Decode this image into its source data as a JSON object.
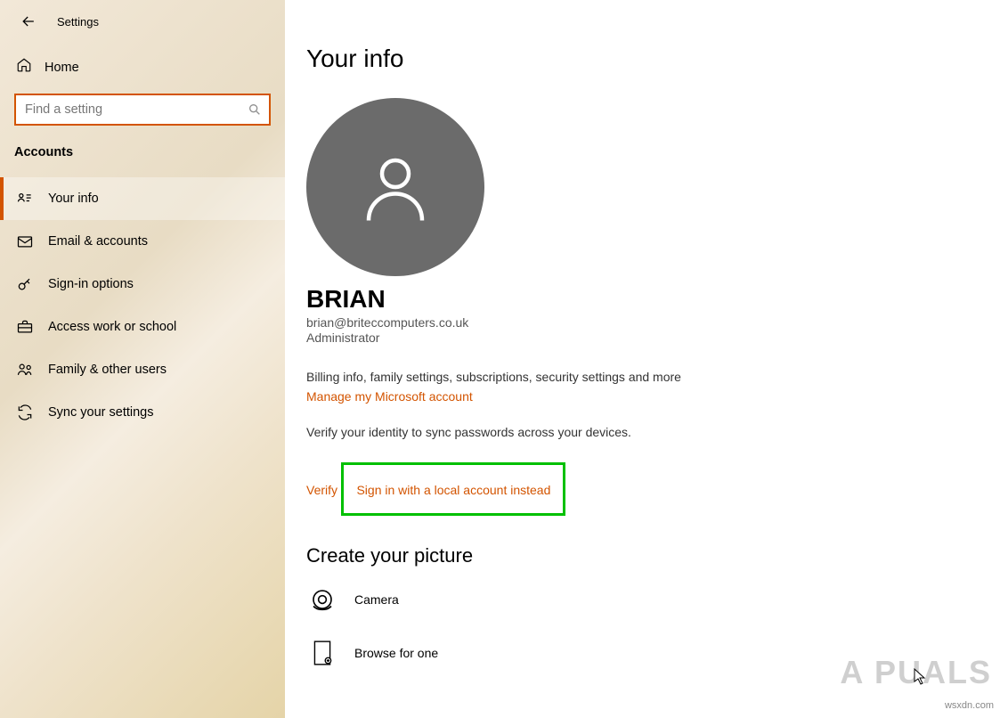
{
  "header": {
    "title": "Settings"
  },
  "home": {
    "label": "Home"
  },
  "search": {
    "placeholder": "Find a setting"
  },
  "section": "Accounts",
  "nav": [
    {
      "label": "Your info",
      "icon": "person-card-icon",
      "active": true
    },
    {
      "label": "Email & accounts",
      "icon": "mail-icon",
      "active": false
    },
    {
      "label": "Sign-in options",
      "icon": "key-icon",
      "active": false
    },
    {
      "label": "Access work or school",
      "icon": "briefcase-icon",
      "active": false
    },
    {
      "label": "Family & other users",
      "icon": "people-icon",
      "active": false
    },
    {
      "label": "Sync your settings",
      "icon": "sync-icon",
      "active": false
    }
  ],
  "main": {
    "page_title": "Your info",
    "user_name": "BRIAN",
    "user_email": "brian@briteccomputers.co.uk",
    "user_role": "Administrator",
    "billing_desc": "Billing info, family settings, subscriptions, security settings and more",
    "manage_link": "Manage my Microsoft account",
    "verify_desc": "Verify your identity to sync passwords across your devices.",
    "verify_link": "Verify",
    "local_account_link": "Sign in with a local account instead",
    "picture_heading": "Create your picture",
    "camera_label": "Camera",
    "browse_label": "Browse for one"
  },
  "watermark": {
    "text": "A  PUALS",
    "site": "wsxdn.com"
  },
  "colors": {
    "accent": "#d35400",
    "highlight": "#00c000"
  }
}
